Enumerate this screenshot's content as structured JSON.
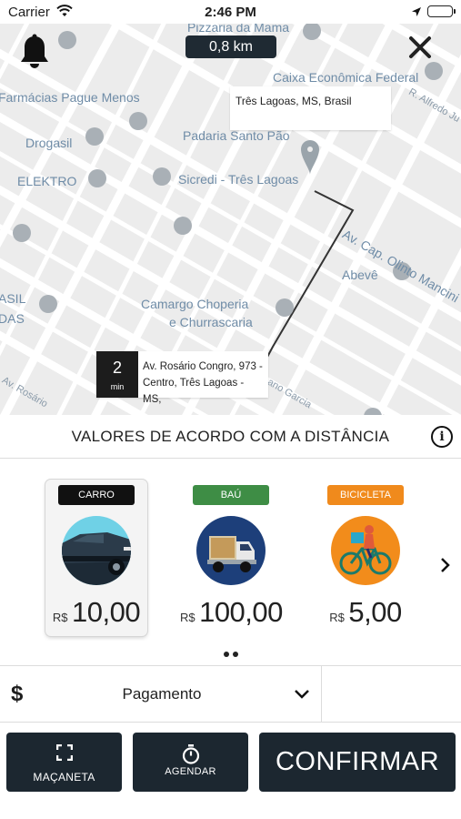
{
  "status_bar": {
    "carrier": "Carrier",
    "time": "2:46 PM"
  },
  "map": {
    "distance": "0,8 km",
    "destination_label": "Três Lagoas, MS, Brasil",
    "origin": {
      "eta_value": "2",
      "eta_unit": "min",
      "address": "Av. Rosário Congro, 973 - Centro, Três Lagoas - MS,"
    },
    "places": {
      "pizzaria": "Pizzaria da Mama",
      "caixa": "Caixa Econômica Federal",
      "farmacias": "Farmácias Pague Menos",
      "drogasil": "Drogasil",
      "padaria": "Padaria Santo Pão",
      "elektro": "ELEKTRO",
      "sicredi": "Sicredi - Três Lagoas",
      "olinto": "Av. Cap. Olinto Mancini",
      "abeve": "Abevê",
      "camargo_1": "Camargo Choperia",
      "camargo_2": "e Churrascaria",
      "asil_1": "ASIL",
      "asil_2": "DAS",
      "rosario": "Av. Rosário",
      "garcia": "ano Garcia",
      "alfredo": "R. Alfredo Ju"
    }
  },
  "values_header": {
    "title": "VALORES DE ACORDO COM A DISTÂNCIA",
    "info_glyph": "i"
  },
  "vehicles": [
    {
      "tag": "CARRO",
      "currency": "R$",
      "price": "10,00",
      "tag_color": "#111111",
      "selected": true
    },
    {
      "tag": "BAÚ",
      "currency": "R$",
      "price": "100,00",
      "tag_color": "#3e8d45",
      "selected": false
    },
    {
      "tag": "BICICLETA",
      "currency": "R$",
      "price": "5,00",
      "tag_color": "#f08a1c",
      "selected": false
    }
  ],
  "payment": {
    "currency_symbol": "$",
    "label": "Pagamento"
  },
  "actions": {
    "macaneta": "MAÇANETA",
    "agendar": "AGENDAR",
    "confirmar": "CONFIRMAR"
  },
  "colors": {
    "button_bg": "#1c2730",
    "map_bg": "#ececec",
    "route": "#333333"
  }
}
